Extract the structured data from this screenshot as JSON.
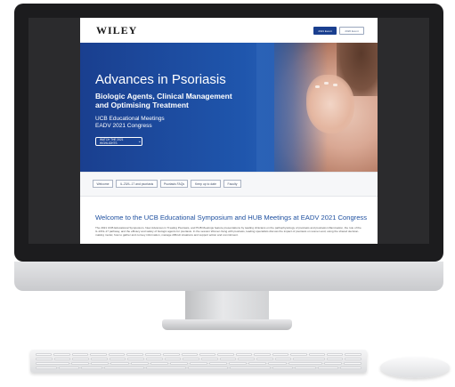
{
  "site": {
    "logo": "WILEY",
    "year_buttons": [
      "2021 Event",
      "2020 Event"
    ]
  },
  "hero": {
    "title": "Advances in Psoriasis",
    "subtitle_line1": "Biologic Agents, Clinical Management",
    "subtitle_line2": "and Optimising Treatment",
    "meta_line1": "UCB Educational Meetings",
    "meta_line2": "EADV 2021 Congress",
    "cta": "WATCH THE 2021 HIGHLIGHTS"
  },
  "nav": {
    "items": [
      "Welcome",
      "IL-23/IL-17 and psoriasis",
      "Psoriasis FAQs",
      "Keep up to date",
      "Faculty"
    ]
  },
  "content": {
    "welcome_title": "Welcome to the UCB Educational Symposium and HUB Meetings at EADV 2021 Congress",
    "paragraph": "The 2021 UCB Educational Symposium, New Advances in Treating Psoriasis, and HUB Meetings feature presentations by leading clinicians on the pathophysiology of psoriasis and psoriasis inflammation, the role of the IL-23/IL-17 pathway, and the efficacy and safety of biologic agents for psoriasis. In the session Women living with psoriasis, leading specialists discuss the impact of psoriasis on women and, using the shared decision-making model, how to gather and convey information, manage difficult situations and support action and commitment."
  },
  "colors": {
    "brand_blue": "#1a3f8f",
    "hero_blue": "#1f56ad",
    "heading_blue": "#1d4f9f"
  },
  "icons": {
    "watch_button_icon": "chevron-down-icon"
  }
}
